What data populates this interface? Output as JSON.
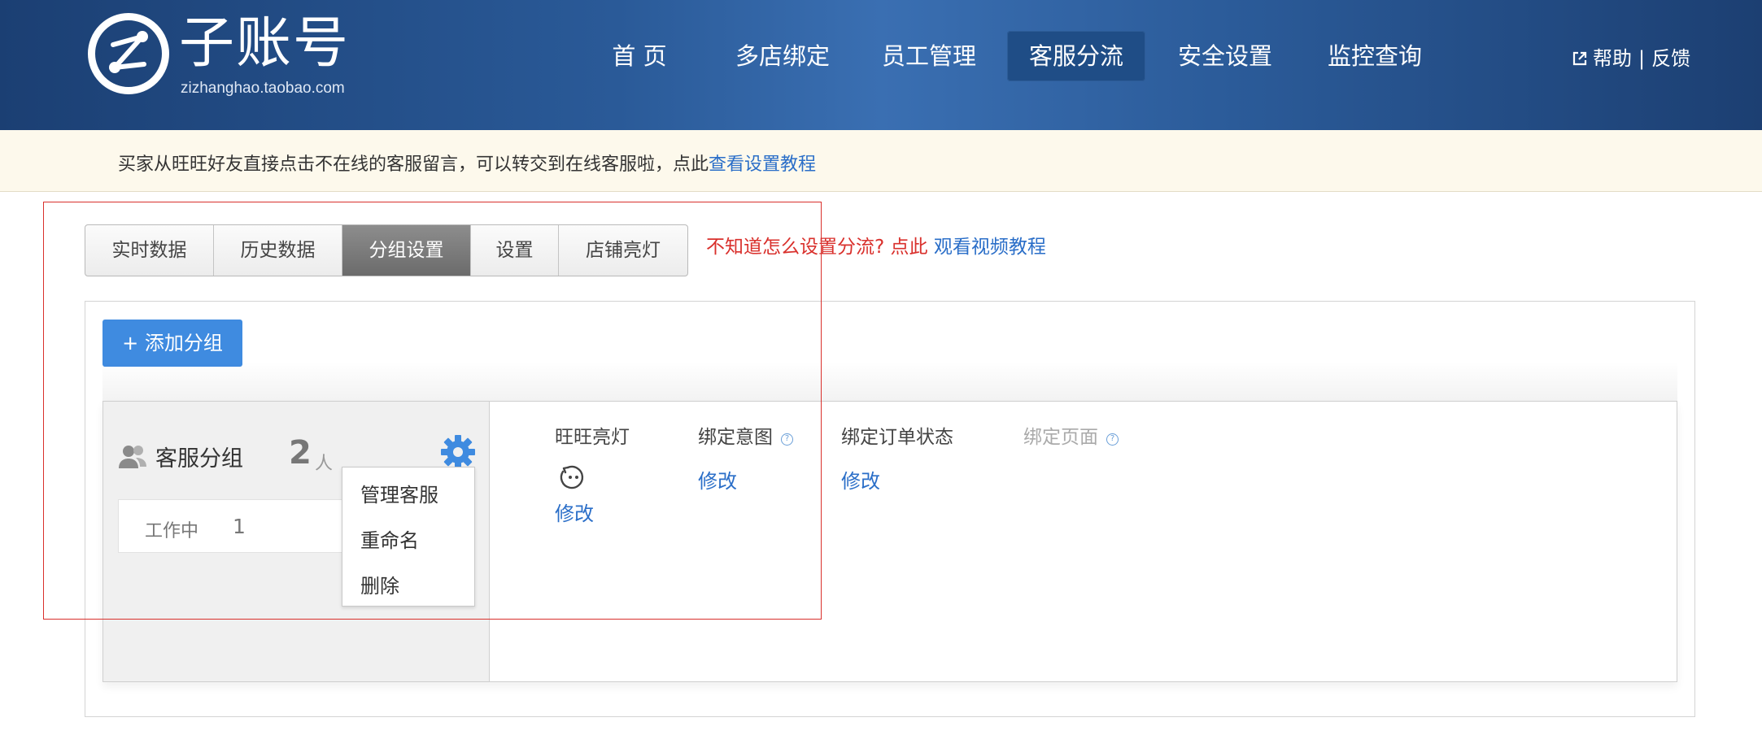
{
  "header": {
    "logo_title": "子账号",
    "logo_subtitle": "zizhanghao.taobao.com",
    "nav": [
      {
        "label": "首 页"
      },
      {
        "label": "多店绑定"
      },
      {
        "label": "员工管理"
      },
      {
        "label": "客服分流",
        "active": true
      },
      {
        "label": "安全设置"
      },
      {
        "label": "监控查询"
      }
    ],
    "help": "帮助",
    "feedback": "反馈",
    "separator": "|"
  },
  "notice": {
    "text": "买家从旺旺好友直接点击不在线的客服留言，可以转交到在线客服啦，点此",
    "link": "查看设置教程"
  },
  "tabs": [
    {
      "label": "实时数据"
    },
    {
      "label": "历史数据"
    },
    {
      "label": "分组设置",
      "active": true
    },
    {
      "label": "设置"
    },
    {
      "label": "店铺亮灯"
    }
  ],
  "tab_help": {
    "text": "不知道怎么设置分流? 点此",
    "link": "观看视频教程"
  },
  "add_group_label": "+ 添加分组",
  "group": {
    "name": "客服分组",
    "count": "2",
    "unit": "人",
    "status_label": "工作中",
    "status_count": "1",
    "menu": [
      "管理客服",
      "重命名",
      "删除"
    ]
  },
  "columns": {
    "wangwang_light": "旺旺亮灯",
    "bind_intent": "绑定意图",
    "bind_order_status": "绑定订单状态",
    "bind_page": "绑定页面",
    "info_glyph": "?",
    "edit": "修改"
  },
  "colors": {
    "header_blue": "#2a5a98",
    "accent_blue": "#3f8be0",
    "link_blue": "#2a6ec8",
    "alert_red": "#d9302c"
  }
}
